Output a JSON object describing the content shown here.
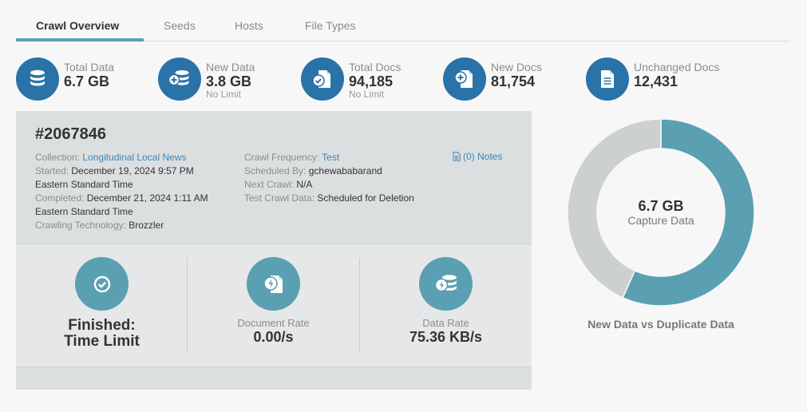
{
  "tabs": [
    {
      "label": "Crawl Overview",
      "active": true
    },
    {
      "label": "Seeds"
    },
    {
      "label": "Hosts"
    },
    {
      "label": "File Types"
    }
  ],
  "stats": {
    "total_data": {
      "label": "Total Data",
      "value": "6.7 GB",
      "icon": "database-icon"
    },
    "new_data": {
      "label": "New Data",
      "value": "3.8 GB",
      "sub": "No Limit",
      "icon": "database-plus-icon"
    },
    "total_docs": {
      "label": "Total Docs",
      "value": "94,185",
      "sub": "No Limit",
      "icon": "document-check-icon"
    },
    "new_docs": {
      "label": "New Docs",
      "value": "81,754",
      "icon": "document-plus-icon"
    },
    "unchanged_docs": {
      "label": "Unchanged Docs",
      "value": "12,431",
      "icon": "document-icon"
    }
  },
  "crawl": {
    "id": "#2067846",
    "collection_label": "Collection:",
    "collection": "Longitudinal Local News",
    "started_label": "Started:",
    "started": "December 19, 2024 9:57 PM",
    "started_tz": "Eastern Standard Time",
    "completed_label": "Completed:",
    "completed": "December 21, 2024 1:11 AM",
    "completed_tz": "Eastern Standard Time",
    "technology_label": "Crawling Technology:",
    "technology": "Brozzler",
    "frequency_label": "Crawl Frequency:",
    "frequency": "Test",
    "scheduled_by_label": "Scheduled By:",
    "scheduled_by": "gchewababarand",
    "next_crawl_label": "Next Crawl:",
    "next_crawl": "N/A",
    "test_data_label": "Test Crawl Data:",
    "test_data": "Scheduled for Deletion",
    "notes": "(0) Notes"
  },
  "metrics": {
    "status_line1": "Finished:",
    "status_line2": "Time Limit",
    "document_rate_label": "Document Rate",
    "document_rate": "0.00/s",
    "data_rate_label": "Data Rate",
    "data_rate": "75.36 KB/s"
  },
  "donut": {
    "value": "6.7 GB",
    "label": "Capture Data",
    "caption": "New Data vs Duplicate Data",
    "new_fraction": 0.567,
    "colors": {
      "new": "#5b9fb2",
      "duplicate": "#cdd0d1"
    }
  },
  "colors": {
    "accent": "#2a73a8",
    "metric": "#5b9fb2",
    "link": "#3a86b8"
  }
}
